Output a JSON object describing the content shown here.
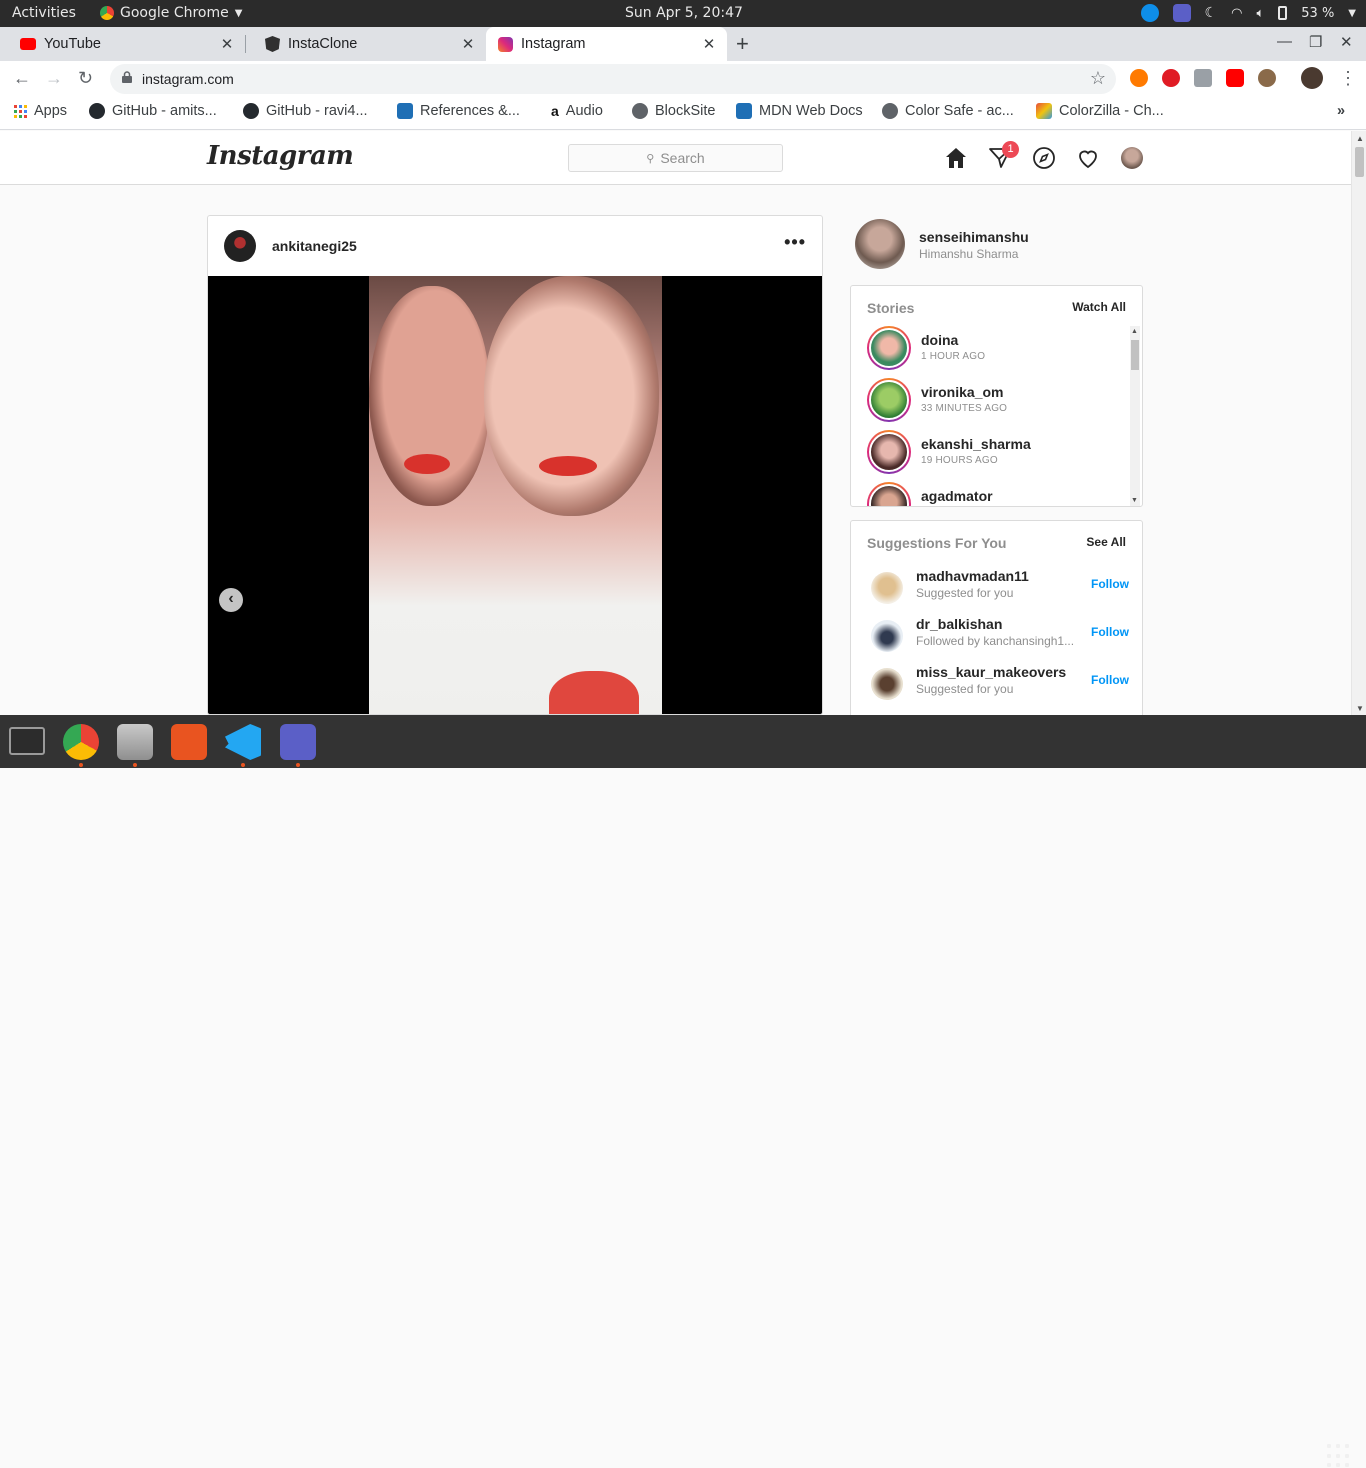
{
  "system": {
    "activities": "Activities",
    "app_name": "Google Chrome",
    "clock": "Sun Apr  5, 20:47",
    "battery": "53 %"
  },
  "browser": {
    "tabs": [
      {
        "title": "YouTube",
        "icon": "youtube-icon"
      },
      {
        "title": "InstaClone",
        "icon": "angular-icon"
      },
      {
        "title": "Instagram",
        "icon": "instagram-icon"
      }
    ],
    "url": "instagram.com",
    "bookmarks": [
      {
        "label": "Apps",
        "icon": "apps-grid-icon"
      },
      {
        "label": "GitHub - amits...",
        "icon": "github-icon"
      },
      {
        "label": "GitHub - ravi4...",
        "icon": "github-icon"
      },
      {
        "label": "References &...",
        "icon": "references-icon"
      },
      {
        "label": "Audio",
        "icon": "amazon-icon"
      },
      {
        "label": "BlockSite",
        "icon": "globe-icon"
      },
      {
        "label": "MDN Web Docs",
        "icon": "mdn-icon"
      },
      {
        "label": "Color Safe - ac...",
        "icon": "globe-icon"
      },
      {
        "label": "ColorZilla - Ch...",
        "icon": "colorzilla-icon"
      }
    ],
    "more_bookmarks": "»"
  },
  "instagram": {
    "logo": "Instagram",
    "search_placeholder": "Search",
    "notification_count": "1",
    "post": {
      "username": "ankitanegi25",
      "more": "•••"
    },
    "me": {
      "username": "senseihimanshu",
      "name": "Himanshu Sharma"
    },
    "stories": {
      "title": "Stories",
      "link": "Watch All",
      "items": [
        {
          "user": "doina",
          "time": "1 HOUR AGO"
        },
        {
          "user": "vironika_om",
          "time": "33 MINUTES AGO"
        },
        {
          "user": "ekanshi_sharma",
          "time": "19 HOURS AGO"
        },
        {
          "user": "agadmator",
          "time": ""
        }
      ]
    },
    "suggestions": {
      "title": "Suggestions For You",
      "link": "See All",
      "items": [
        {
          "user": "madhavmadan11",
          "sub": "Suggested for you",
          "action": "Follow"
        },
        {
          "user": "dr_balkishan",
          "sub": "Followed by kanchansingh1...",
          "action": "Follow"
        },
        {
          "user": "miss_kaur_makeovers",
          "sub": "Suggested for you",
          "action": "Follow"
        }
      ]
    }
  },
  "colors": {
    "accent_blue": "#0095f6",
    "badge_red": "#ed4956",
    "ubuntu_orange": "#e95420"
  }
}
